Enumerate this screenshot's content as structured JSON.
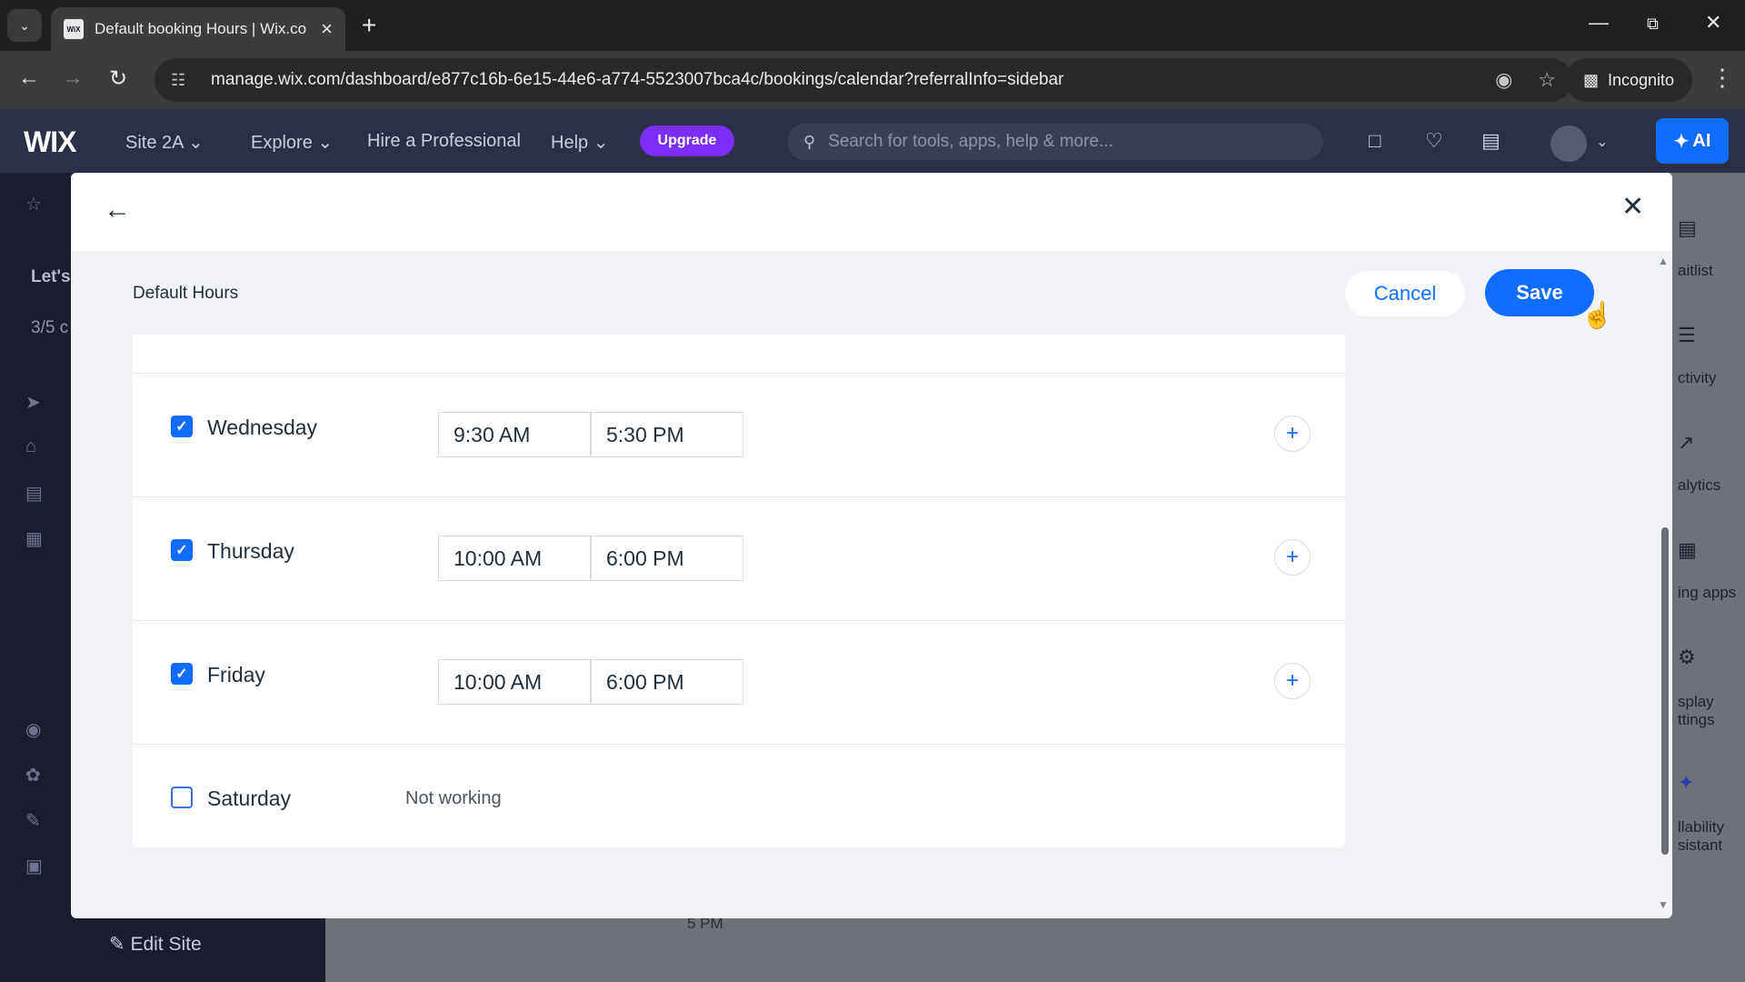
{
  "browser": {
    "tab_title": "Default booking Hours | Wix.co",
    "favicon_text": "WiX",
    "url": "manage.wix.com/dashboard/e877c16b-6e15-44e6-a774-5523007bca4c/bookings/calendar?referralInfo=sidebar",
    "incognito_label": "Incognito"
  },
  "wix_header": {
    "logo": "WIX",
    "site_name": "Site 2A",
    "nav": [
      "Explore",
      "Hire a Professional",
      "Help"
    ],
    "upgrade_label": "Upgrade",
    "search_placeholder": "Search for tools, apps, help & more...",
    "ai_label": "AI"
  },
  "background": {
    "sidebar_fragments": [
      "Let's",
      "3/5 c"
    ],
    "edit_site_label": "Edit Site",
    "right_rail_labels": [
      "aitlist",
      "ctivity",
      "alytics",
      "ing apps",
      "splay",
      "ttings",
      "llability",
      "sistant"
    ],
    "time_label": "5 PM"
  },
  "modal": {
    "title": "Default Hours",
    "cancel_label": "Cancel",
    "save_label": "Save",
    "days": [
      {
        "name": "Wednesday",
        "checked": true,
        "start": "9:30 AM",
        "end": "5:30 PM"
      },
      {
        "name": "Thursday",
        "checked": true,
        "start": "10:00 AM",
        "end": "6:00 PM"
      },
      {
        "name": "Friday",
        "checked": true,
        "start": "10:00 AM",
        "end": "6:00 PM"
      },
      {
        "name": "Saturday",
        "checked": false,
        "status": "Not working"
      }
    ]
  },
  "colors": {
    "accent": "#116dff",
    "upgrade": "#7b2ef5",
    "wix_bar": "#2b3046"
  }
}
